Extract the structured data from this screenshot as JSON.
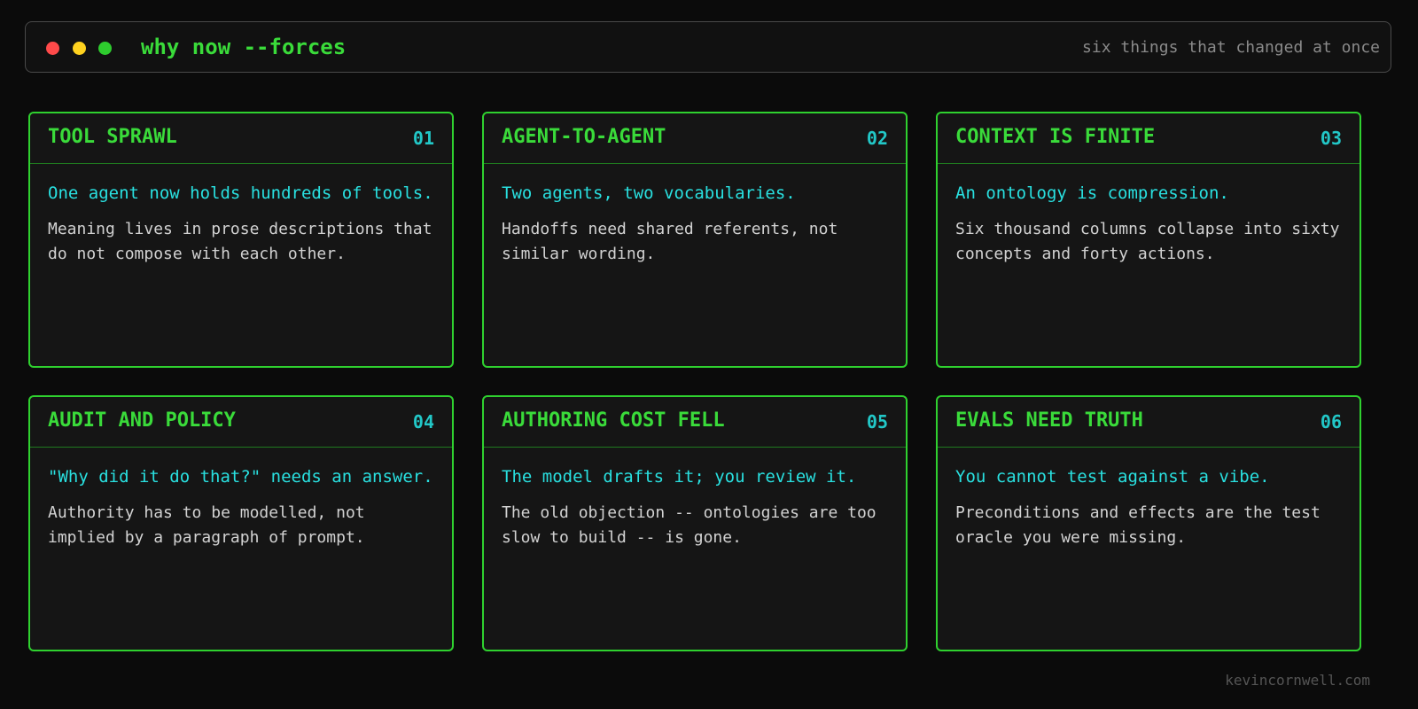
{
  "window": {
    "dots": [
      {
        "name": "close",
        "color": "#ff4a4a"
      },
      {
        "name": "minimize",
        "color": "#ffd21f"
      },
      {
        "name": "maximize",
        "color": "#2ecc2e"
      }
    ],
    "title": "why now --forces",
    "subtitle": "six things that changed at once"
  },
  "cards": [
    {
      "title": "TOOL SPRAWL",
      "number": "01",
      "lead": "One agent now holds hundreds of tools.",
      "detail": "Meaning lives in prose descriptions that do not compose with each other."
    },
    {
      "title": "AGENT-TO-AGENT",
      "number": "02",
      "lead": "Two agents, two vocabularies.",
      "detail": "Handoffs need shared referents, not similar wording."
    },
    {
      "title": "CONTEXT IS FINITE",
      "number": "03",
      "lead": "An ontology is compression.",
      "detail": "Six thousand columns collapse into sixty concepts and forty actions."
    },
    {
      "title": "AUDIT AND POLICY",
      "number": "04",
      "lead": "\"Why did it do that?\" needs an answer.",
      "detail": "Authority has to be modelled, not implied by a paragraph of prompt."
    },
    {
      "title": "AUTHORING COST FELL",
      "number": "05",
      "lead": "The model drafts it; you review it.",
      "detail": "The old objection -- ontologies are too slow to build -- is gone."
    },
    {
      "title": "EVALS NEED TRUTH",
      "number": "06",
      "lead": "You cannot test against a vibe.",
      "detail": "Preconditions and effects are the test oracle you were missing."
    }
  ],
  "footer": "kevincornwell.com",
  "colors": {
    "accent_green": "#3adb3a",
    "accent_cyan": "#29e0e0",
    "background": "#0b0b0b",
    "card_background": "#151515"
  }
}
